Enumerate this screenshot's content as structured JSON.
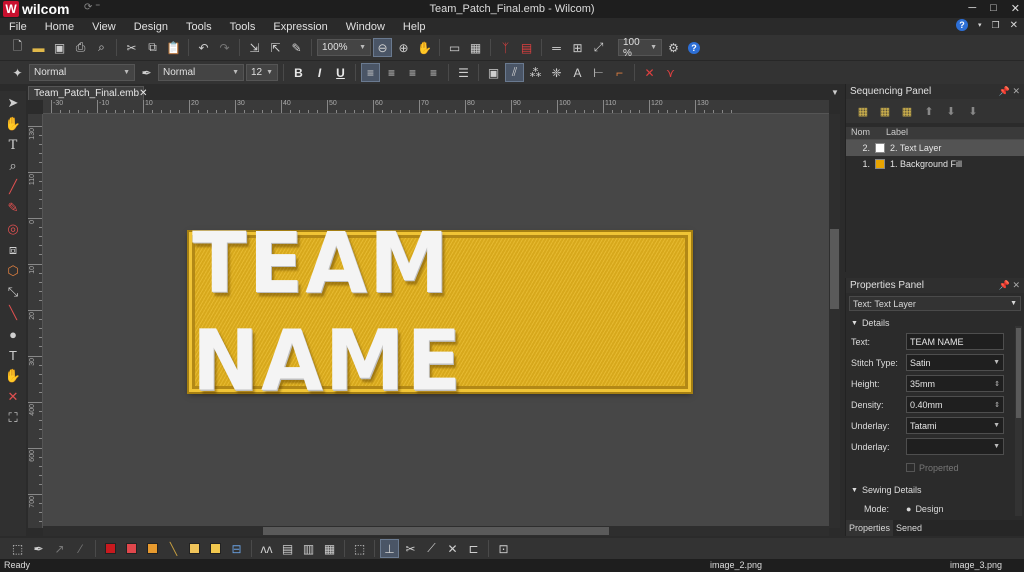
{
  "app": {
    "logo_text": "wilcom",
    "window_title": "Team_Patch_Final.emb - Wilcom)"
  },
  "menu": [
    "File",
    "Home",
    "View",
    "Design",
    "Tools",
    "Tools",
    "Expression",
    "Window",
    "Help"
  ],
  "toolbar1": {
    "zoom1": "100%",
    "zoom2": "100 %"
  },
  "toolbar2": {
    "style1": "Normal",
    "style2": "Normal",
    "size": "12",
    "bold": "B",
    "italic": "I",
    "underline": "U"
  },
  "document": {
    "tab_label": "Team_Patch_Final.emb",
    "patch_text": "TEAM NAME",
    "patch_color": "#e4b31e"
  },
  "ruler": {
    "h": [
      "-30",
      "-10",
      "10",
      "20",
      "30",
      "40",
      "50",
      "60",
      "70",
      "80",
      "90",
      "100",
      "110",
      "120",
      "130"
    ],
    "v": [
      "130",
      "110",
      "0",
      "10",
      "20",
      "30",
      "400",
      "600",
      "700"
    ]
  },
  "sequencing": {
    "title": "Sequencing Panel",
    "col_num": "Nom",
    "col_label": "Label",
    "rows": [
      {
        "num": "2.",
        "label": "2. Text Layer",
        "color": "#ffffff"
      },
      {
        "num": "1.",
        "label": "1. Background Fill",
        "color": "#e8a400"
      }
    ]
  },
  "properties": {
    "title": "Properties Panel",
    "selector_label": "Text:",
    "selector_value": "Text Layer",
    "details": "Details",
    "fields": [
      {
        "label": "Text:",
        "value": "TEAM NAME"
      },
      {
        "label": "Stitch Type:",
        "value": "Satin"
      },
      {
        "label": "Height:",
        "value": "35mm"
      },
      {
        "label": "Density:",
        "value": "0.40mm"
      },
      {
        "label": "Underlay:",
        "value": "Tatami"
      },
      {
        "label": "Underlay:",
        "value": ""
      }
    ],
    "properted": "Properted",
    "sewing_details": "Sewing Details",
    "mode_label": "Mode:",
    "mode_value": "Design",
    "tab1": "Properties",
    "tab2": "Sened"
  },
  "palette": [
    "#c8191e",
    "#e0474c",
    "#e79a2e",
    "#f0c45a",
    "#f2c84e"
  ],
  "status": {
    "left": "Ready",
    "mid": "image_2.png",
    "right": "image_3.png"
  }
}
